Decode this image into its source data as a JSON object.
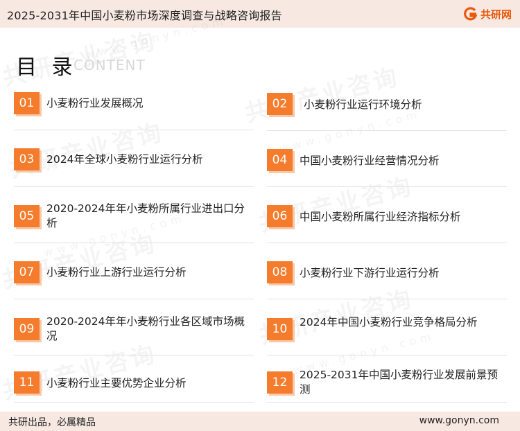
{
  "header": {
    "title": "2025-2031年中国小麦粉市场深度调查与战略咨询报告",
    "brand": "共研网",
    "accent": "#e8590c"
  },
  "toc": {
    "title": "目 录",
    "subtitle": "CONTENT"
  },
  "watermark": {
    "text": "共研产业咨询",
    "url": "www.gonyn.com"
  },
  "items": [
    {
      "num": "01",
      "label": "小麦粉行业发展概况"
    },
    {
      "num": "02",
      "label": "小麦粉行业运行环境分析"
    },
    {
      "num": "03",
      "label": "2024年全球小麦粉行业运行分析"
    },
    {
      "num": "04",
      "label": "中国小麦粉行业经营情况分析"
    },
    {
      "num": "05",
      "label": "2020-2024年年小麦粉所属行业进出口分析"
    },
    {
      "num": "06",
      "label": "中国小麦粉所属行业经济指标分析"
    },
    {
      "num": "07",
      "label": "小麦粉行业上游行业运行分析"
    },
    {
      "num": "08",
      "label": "小麦粉行业下游行业运行分析"
    },
    {
      "num": "09",
      "label": "2020-2024年年小麦粉行业各区域市场概况"
    },
    {
      "num": "10",
      "label": "2024年中国小麦粉行业竞争格局分析"
    },
    {
      "num": "11",
      "label": "小麦粉行业主要优势企业分析"
    },
    {
      "num": "12",
      "label": "2025-2031年中国小麦粉行业发展前景预测"
    }
  ],
  "footer": {
    "slogan": "共研出品，必属精品",
    "url": "www.gonyn.com"
  }
}
